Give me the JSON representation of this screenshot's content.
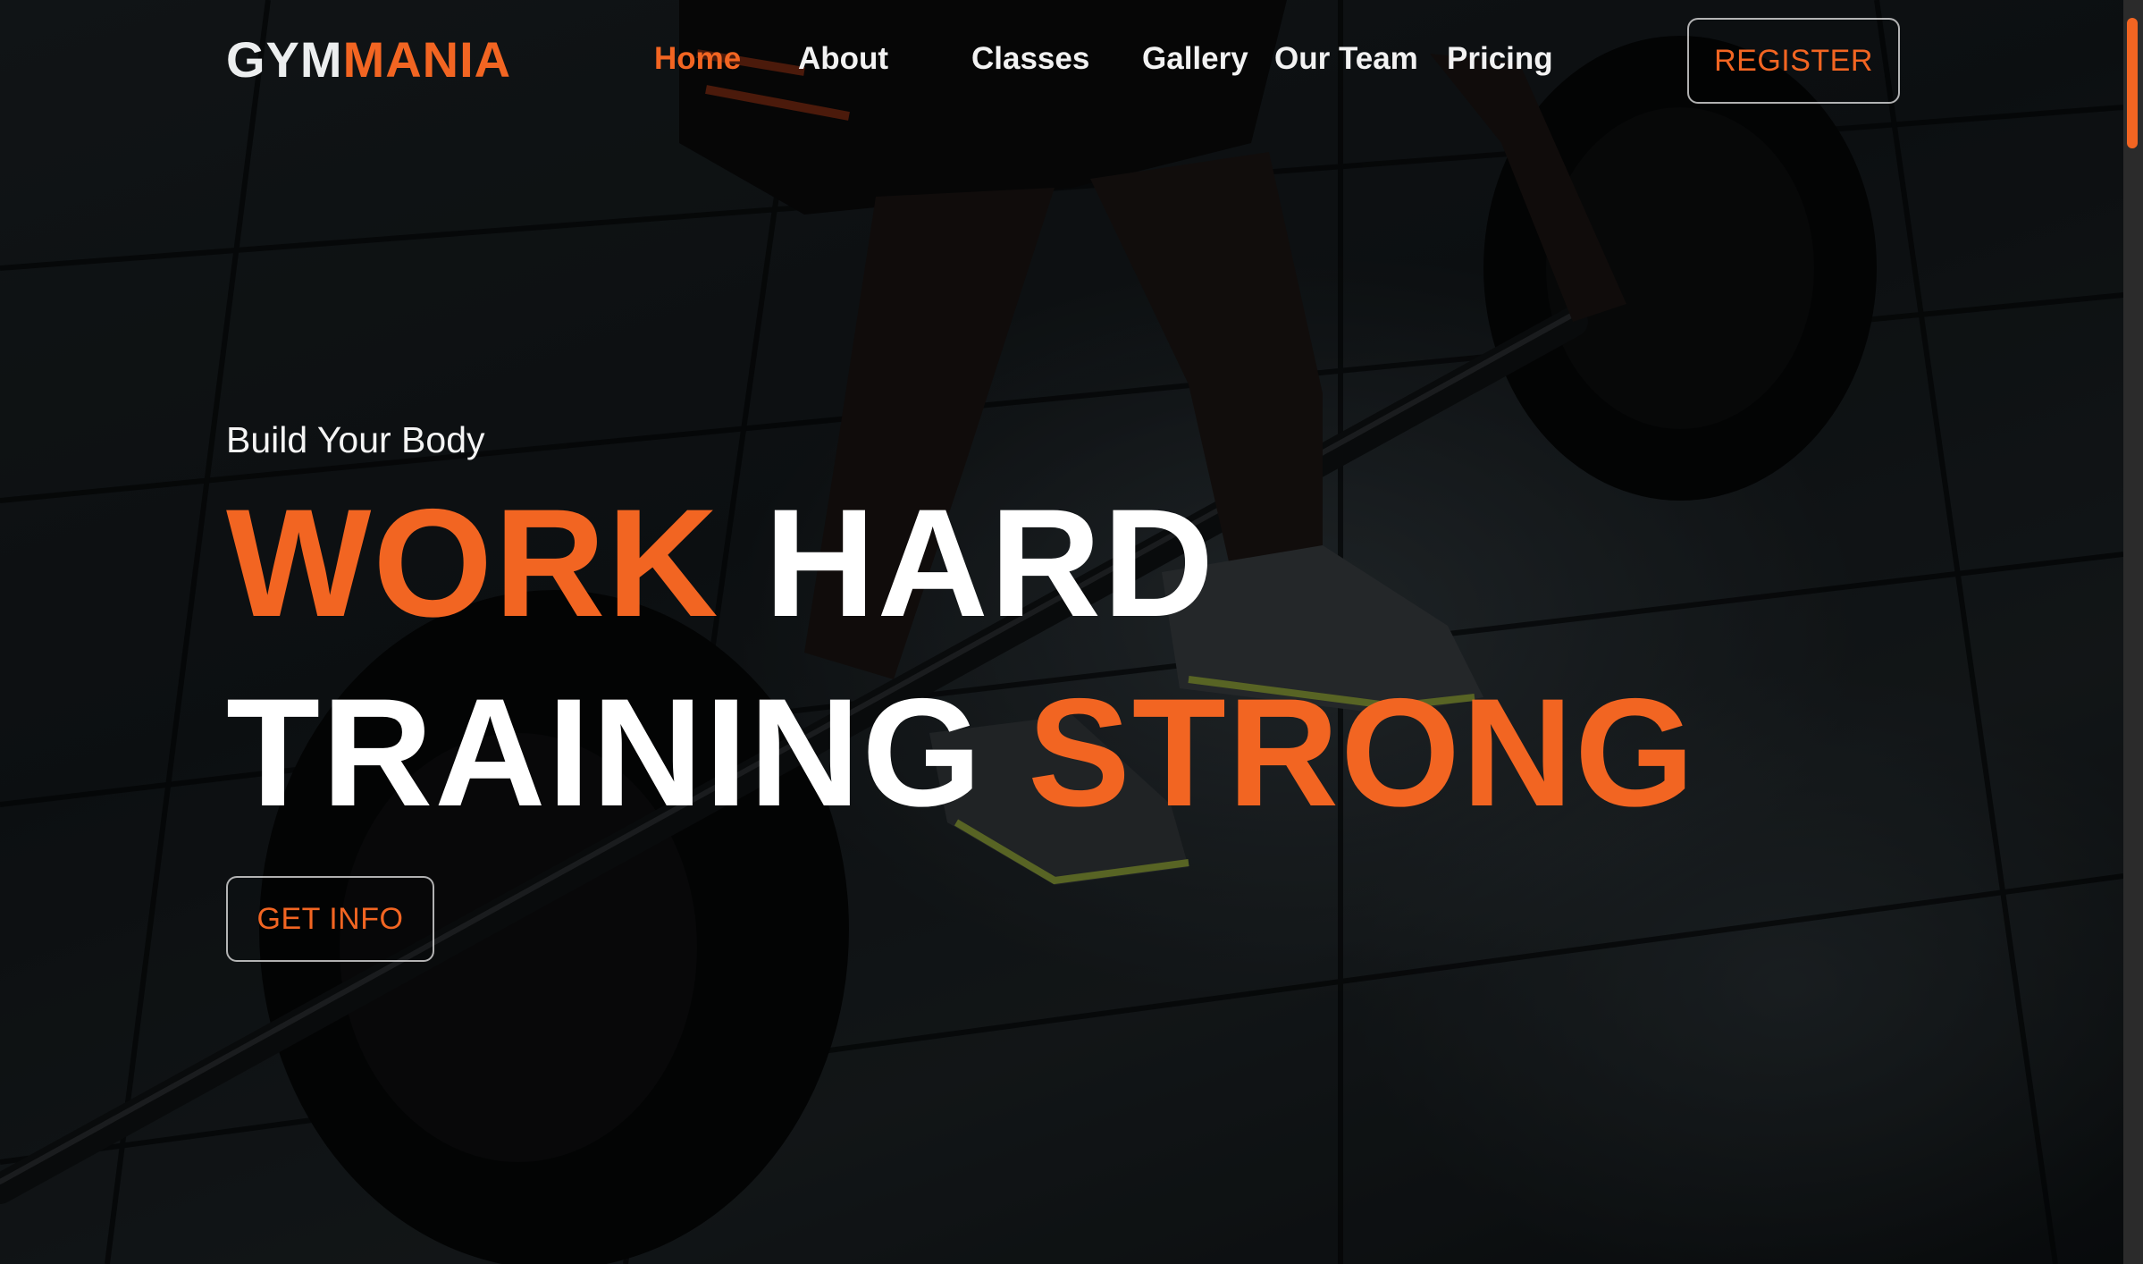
{
  "brand": {
    "part1": "GYM",
    "part2": "MANIA"
  },
  "nav": {
    "items": [
      {
        "label": "Home",
        "active": true
      },
      {
        "label": "About"
      },
      {
        "label": "Classes"
      },
      {
        "label": "Gallery"
      },
      {
        "label": "Our Team"
      },
      {
        "label": "Pricing"
      }
    ],
    "register_label": "REGISTER"
  },
  "hero": {
    "subtitle": "Build Your Body",
    "line1": {
      "orange": "WORK",
      "white": "HARD"
    },
    "line2": {
      "white": "TRAINING",
      "orange": "STRONG"
    },
    "cta_label": "GET INFO"
  },
  "colors": {
    "accent": "#f26522",
    "text": "#ffffff",
    "background": "#101416"
  }
}
